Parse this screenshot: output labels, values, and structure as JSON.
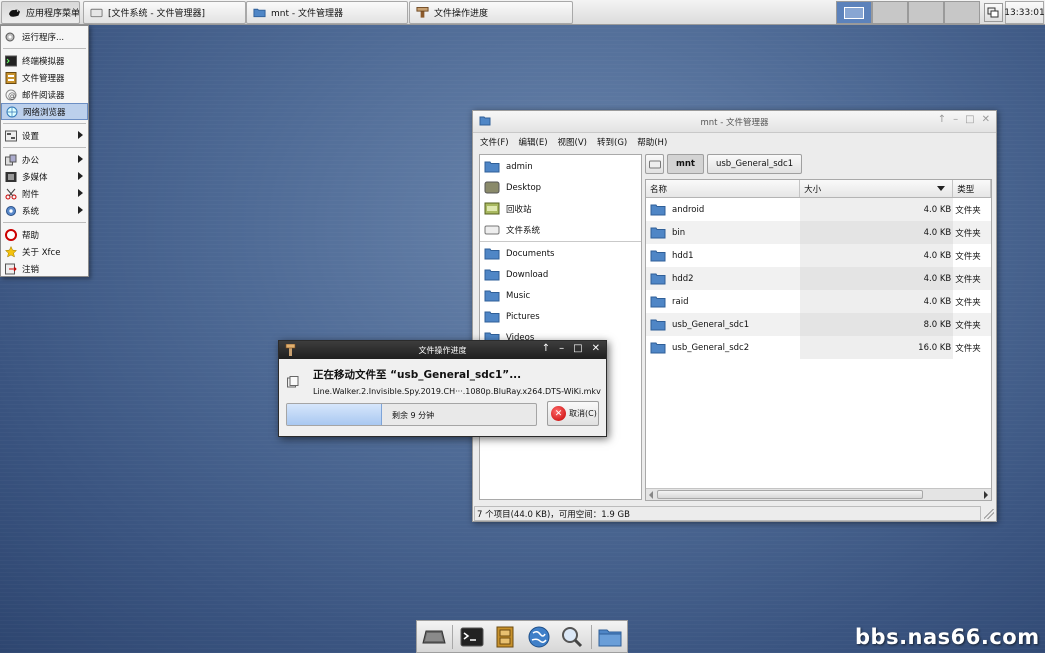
{
  "top_panel": {
    "app_menu_label": "应用程序菜单",
    "tasks": [
      {
        "label": "[文件系统 - 文件管理器]"
      },
      {
        "label": "mnt - 文件管理器"
      },
      {
        "label": "文件操作进度"
      }
    ],
    "clock": "13:33:01"
  },
  "app_menu": {
    "run": "运行程序...",
    "favorites": [
      "终端模拟器",
      "文件管理器",
      "邮件阅读器",
      "网络浏览器"
    ],
    "settings": "设置",
    "categories": [
      "办公",
      "多媒体",
      "附件",
      "系统"
    ],
    "help": "帮助",
    "about": "关于 Xfce",
    "logout": "注销"
  },
  "file_manager": {
    "title": "mnt - 文件管理器",
    "menus": [
      "文件(F)",
      "编辑(E)",
      "视图(V)",
      "转到(G)",
      "帮助(H)"
    ],
    "sidebar": {
      "devices": [
        "admin",
        "Desktop",
        "回收站",
        "文件系统"
      ],
      "places": [
        "Documents",
        "Download",
        "Music",
        "Pictures",
        "Videos"
      ]
    },
    "path": [
      "mnt",
      "usb_General_sdc1"
    ],
    "columns": {
      "name": "名称",
      "size": "大小",
      "type": "类型"
    },
    "rows": [
      {
        "name": "android",
        "size": "4.0 KB",
        "type": "文件夹"
      },
      {
        "name": "bin",
        "size": "4.0 KB",
        "type": "文件夹"
      },
      {
        "name": "hdd1",
        "size": "4.0 KB",
        "type": "文件夹"
      },
      {
        "name": "hdd2",
        "size": "4.0 KB",
        "type": "文件夹"
      },
      {
        "name": "raid",
        "size": "4.0 KB",
        "type": "文件夹"
      },
      {
        "name": "usb_General_sdc1",
        "size": "8.0 KB",
        "type": "文件夹"
      },
      {
        "name": "usb_General_sdc2",
        "size": "16.0 KB",
        "type": "文件夹"
      }
    ],
    "status": "7 个项目(44.0 KB)，可用空间：1.9 GB"
  },
  "progress_dialog": {
    "title": "文件操作进度",
    "heading": "正在移动文件至 “usb_General_sdc1”...",
    "filename": "Line.Walker.2.Invisible.Spy.2019.CH···.1080p.BluRay.x264.DTS-WiKi.mkv",
    "progress_percent": 38,
    "remaining": "剩余 9 分钟",
    "cancel_label": "取消(C)"
  },
  "watermark": "bbs.nas66.com",
  "colors": {
    "accent": "#5c82bb",
    "folder": "#4f86c6",
    "progress_fill": "#a9c8f1"
  }
}
